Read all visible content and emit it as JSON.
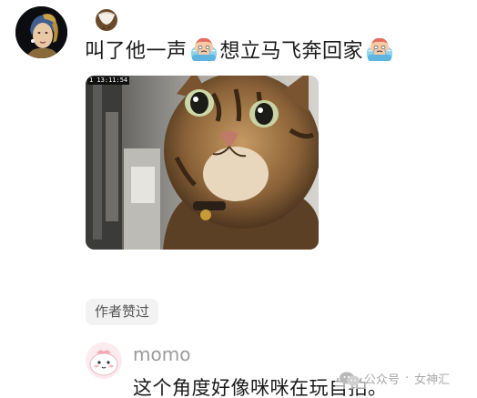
{
  "comment": {
    "part1": "叫了他一声",
    "emoji1": "cry-emoji",
    "part2": " 想立马飞奔回家",
    "emoji2": "cry-emoji"
  },
  "photo": {
    "stamp": "1 13:11:54"
  },
  "author_liked": {
    "label": "作者赞过"
  },
  "reply": {
    "name": "momo",
    "text": "这个角度好像咪咪在玩自拍。"
  },
  "watermark": {
    "account_type": "公众号",
    "separator": "·",
    "account_name": "女神汇"
  },
  "icons": {
    "badge": "coconut-icon",
    "emoji": "crying-face-icon",
    "watermark_logo": "wechat-logo-icon"
  },
  "colors": {
    "text": "#1a1a1a",
    "muted": "#9a9a9a",
    "chip_bg": "#f2f2f2"
  }
}
